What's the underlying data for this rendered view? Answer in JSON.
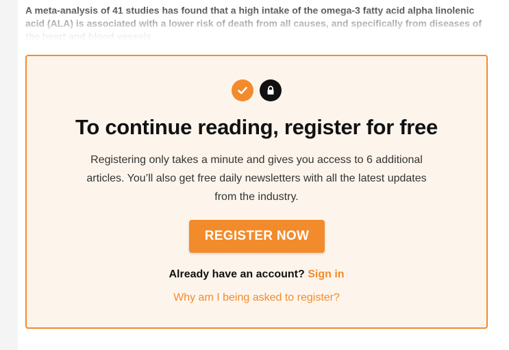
{
  "article": {
    "teaser": "A meta-analysis of 41 studies has found that a high intake of the omega-3 fatty acid alpha linolenic acid (ALA) is associated with a lower risk of death from all causes, and specifically from diseases of the heart and blood vessels."
  },
  "regwall": {
    "icons": [
      "check-icon",
      "lock-icon"
    ],
    "title": "To continue reading, register for free",
    "description": "Registering only takes a minute and gives you access to 6 additional articles. You’ll also get free daily newsletters with all the latest updates from the industry.",
    "register_button": "REGISTER NOW",
    "account_prompt": "Already have an account?",
    "sign_in_link": "Sign in",
    "why_link": "Why am I being asked to register?"
  },
  "colors": {
    "accent": "#f28b2c",
    "panel_background": "#fdf5ec",
    "text_dark": "#111111"
  }
}
